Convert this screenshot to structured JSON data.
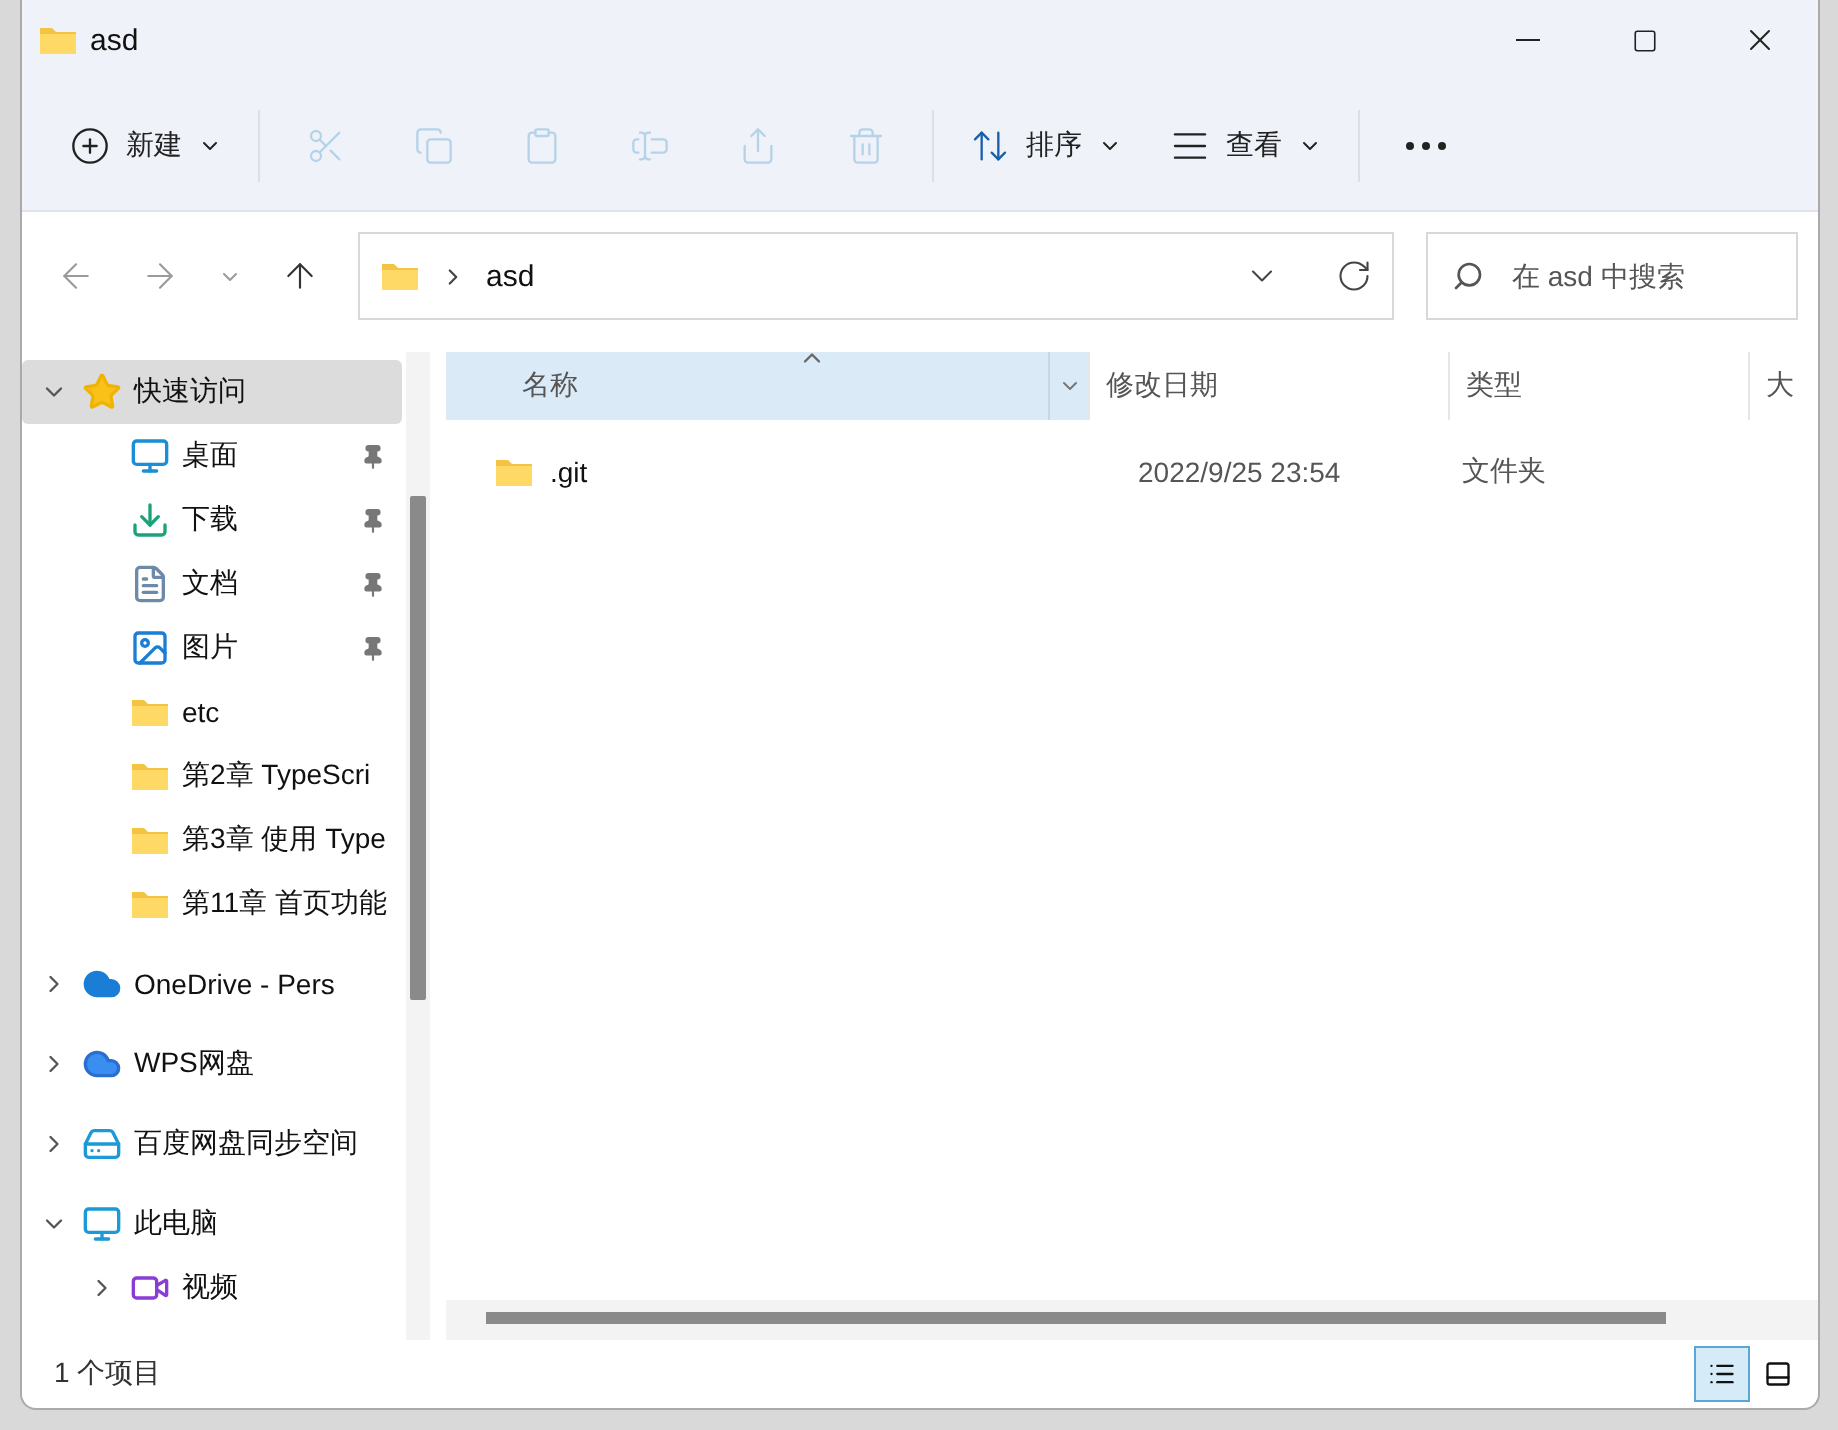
{
  "window": {
    "title": "asd"
  },
  "toolbar": {
    "new_button": {
      "label": "新建"
    },
    "actions": [
      {
        "kind": "cut",
        "disabled": true
      },
      {
        "kind": "copy",
        "disabled": true
      },
      {
        "kind": "paste",
        "disabled": true
      },
      {
        "kind": "rename",
        "disabled": true
      },
      {
        "kind": "share",
        "disabled": true
      },
      {
        "kind": "delete",
        "disabled": true
      }
    ],
    "sort_button": {
      "label": "排序"
    },
    "view_button": {
      "label": "查看"
    }
  },
  "navigation": {
    "back": {
      "disabled": true
    },
    "forward": {
      "disabled": true
    },
    "up": {
      "disabled": false
    }
  },
  "address": {
    "path": [
      "asd"
    ]
  },
  "search": {
    "placeholder": "在 asd 中搜索"
  },
  "sidebar": {
    "items": [
      {
        "label": "快速访问",
        "kind": "star",
        "expanded": true,
        "selected": true,
        "children": [
          {
            "label": "桌面",
            "kind": "desktop",
            "pinned": true,
            "selected": false
          },
          {
            "label": "下载",
            "kind": "download",
            "pinned": true,
            "selected": false
          },
          {
            "label": "文档",
            "kind": "document",
            "pinned": true,
            "selected": false
          },
          {
            "label": "图片",
            "kind": "picture",
            "pinned": true,
            "selected": false
          },
          {
            "label": "etc",
            "kind": "folder",
            "pinned": false,
            "selected": false
          },
          {
            "label": "第2章 TypeScri",
            "kind": "folder",
            "pinned": false,
            "selected": false
          },
          {
            "label": "第3章 使用 Type",
            "kind": "folder",
            "pinned": false,
            "selected": false
          },
          {
            "label": "第11章 首页功能",
            "kind": "folder",
            "pinned": false,
            "selected": false
          }
        ]
      },
      {
        "label": "OneDrive - Pers",
        "kind": "cloud",
        "expanded": false,
        "selected": false
      },
      {
        "label": "WPS网盘",
        "kind": "wps",
        "expanded": false,
        "selected": false
      },
      {
        "label": "百度网盘同步空间",
        "kind": "baidu",
        "expanded": false,
        "selected": false
      },
      {
        "label": "此电脑",
        "kind": "computer",
        "expanded": true,
        "selected": false,
        "children": [
          {
            "label": "视频",
            "kind": "video",
            "expanded": false,
            "selected": false
          }
        ]
      }
    ]
  },
  "table": {
    "columns": [
      {
        "label": "名称",
        "sorted": true
      },
      {
        "label": "修改日期",
        "sorted": false
      },
      {
        "label": "类型",
        "sorted": false
      },
      {
        "label": "大",
        "sorted": false
      }
    ],
    "rows": [
      {
        "name": ".git",
        "date": "2022/9/25 23:54",
        "type": "文件夹"
      }
    ]
  },
  "status_bar": {
    "count": "1 个项目",
    "views": [
      {
        "kind": "details",
        "selected": true
      },
      {
        "kind": "tiles",
        "selected": false
      }
    ]
  }
}
